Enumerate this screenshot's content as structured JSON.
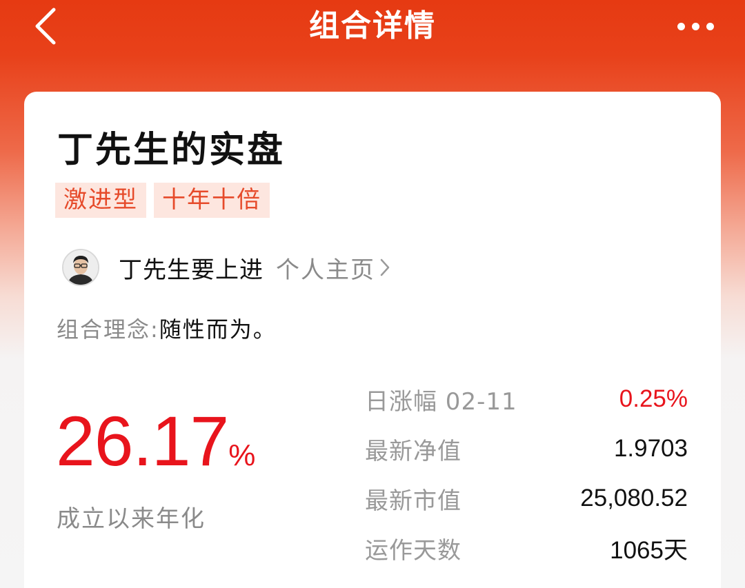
{
  "header": {
    "title": "组合详情"
  },
  "portfolio": {
    "name": "丁先生的实盘",
    "tags": [
      "激进型",
      "十年十倍"
    ],
    "author": {
      "name": "丁先生要上进",
      "homepage_label": "个人主页"
    },
    "philosophy": {
      "label": "组合理念:",
      "value": "随性而为。"
    },
    "annualized": {
      "value": "26.17",
      "unit": "%",
      "label": "成立以来年化"
    },
    "stats": [
      {
        "label": "日涨幅 02-11",
        "value": "0.25%",
        "color": "#e8141c"
      },
      {
        "label": "最新净值",
        "value": "1.9703"
      },
      {
        "label": "最新市值",
        "value": "25,080.52"
      },
      {
        "label": "运作天数",
        "value": "1065天"
      }
    ]
  },
  "colors": {
    "brand": "#e63a12",
    "up": "#e8141c",
    "tag_bg": "#fde6df",
    "tag_text": "#e64a2a"
  },
  "icons": {
    "back": "chevron-left-icon",
    "more": "more-dots-icon",
    "link": "chevron-right-icon"
  }
}
